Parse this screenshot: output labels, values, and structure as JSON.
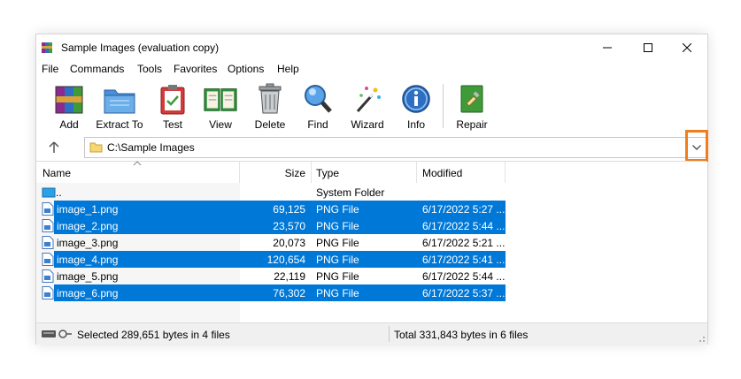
{
  "window": {
    "title": "Sample Images (evaluation copy)"
  },
  "menu": [
    "File",
    "Commands",
    "Tools",
    "Favorites",
    "Options",
    "Help"
  ],
  "toolbar": [
    {
      "label": "Add",
      "icon": "add-archive-icon"
    },
    {
      "label": "Extract To",
      "icon": "extract-to-folder-icon"
    },
    {
      "label": "Test",
      "icon": "test-clipboard-icon"
    },
    {
      "label": "View",
      "icon": "view-book-icon"
    },
    {
      "label": "Delete",
      "icon": "trash-can-icon"
    },
    {
      "label": "Find",
      "icon": "magnifier-icon"
    },
    {
      "label": "Wizard",
      "icon": "magic-wand-icon"
    },
    {
      "label": "Info",
      "icon": "info-icon"
    },
    {
      "label": "Repair",
      "icon": "repair-kit-icon"
    }
  ],
  "address": {
    "path": "C:\\Sample Images"
  },
  "columns": {
    "name": "Name",
    "size": "Size",
    "type": "Type",
    "modified": "Modified"
  },
  "rows": [
    {
      "name": "..",
      "size": "",
      "type": "System Folder",
      "modified": "",
      "selected": false
    },
    {
      "name": "image_1.png",
      "size": "69,125",
      "type": "PNG File",
      "modified": "6/17/2022 5:27 ...",
      "selected": true
    },
    {
      "name": "image_2.png",
      "size": "23,570",
      "type": "PNG File",
      "modified": "6/17/2022 5:44 ...",
      "selected": true
    },
    {
      "name": "image_3.png",
      "size": "20,073",
      "type": "PNG File",
      "modified": "6/17/2022 5:21 ...",
      "selected": false
    },
    {
      "name": "image_4.png",
      "size": "120,654",
      "type": "PNG File",
      "modified": "6/17/2022 5:41 ...",
      "selected": true
    },
    {
      "name": "image_5.png",
      "size": "22,119",
      "type": "PNG File",
      "modified": "6/17/2022 5:44 ...",
      "selected": false
    },
    {
      "name": "image_6.png",
      "size": "76,302",
      "type": "PNG File",
      "modified": "6/17/2022 5:37 ...",
      "selected": true
    }
  ],
  "status": {
    "selected": "Selected 289,651 bytes in 4 files",
    "total": "Total 331,843 bytes in 6 files"
  },
  "colors": {
    "selection": "#0078d7",
    "highlight": "#f07d1e"
  }
}
